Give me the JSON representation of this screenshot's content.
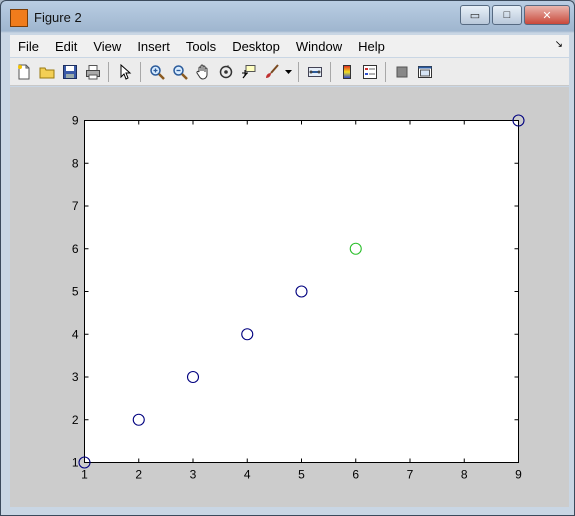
{
  "window": {
    "title": "Figure 2",
    "minimize_symbol": "▭",
    "maximize_symbol": "□",
    "close_symbol": "✕"
  },
  "menu": {
    "items": [
      "File",
      "Edit",
      "View",
      "Insert",
      "Tools",
      "Desktop",
      "Window",
      "Help"
    ],
    "overflow_arrow": "↘"
  },
  "toolbar": {
    "icons": [
      "new-figure-icon",
      "open-file-icon",
      "save-icon",
      "print-icon",
      "edit-plot-arrow-icon",
      "zoom-in-icon",
      "zoom-out-icon",
      "pan-hand-icon",
      "rotate-3d-icon",
      "data-cursor-icon",
      "brush-icon",
      "link-plot-icon",
      "insert-colorbar-icon",
      "insert-legend-icon",
      "hide-plot-tools-icon",
      "show-plot-tools-icon"
    ]
  },
  "chart_data": {
    "type": "scatter",
    "marker": "circle",
    "xlim": [
      1,
      9
    ],
    "ylim": [
      1,
      9
    ],
    "xticks": [
      1,
      2,
      3,
      4,
      5,
      6,
      7,
      8,
      9
    ],
    "yticks": [
      1,
      2,
      3,
      4,
      5,
      6,
      7,
      8,
      9
    ],
    "grid": false,
    "points": [
      {
        "x": 1,
        "y": 1,
        "color": "#00007f"
      },
      {
        "x": 2,
        "y": 2,
        "color": "#00007f"
      },
      {
        "x": 3,
        "y": 3,
        "color": "#00007f"
      },
      {
        "x": 4,
        "y": 4,
        "color": "#00007f"
      },
      {
        "x": 5,
        "y": 5,
        "color": "#00007f"
      },
      {
        "x": 6,
        "y": 6,
        "color": "#2bbf2b"
      },
      {
        "x": 9,
        "y": 9,
        "color": "#00007f"
      }
    ]
  }
}
